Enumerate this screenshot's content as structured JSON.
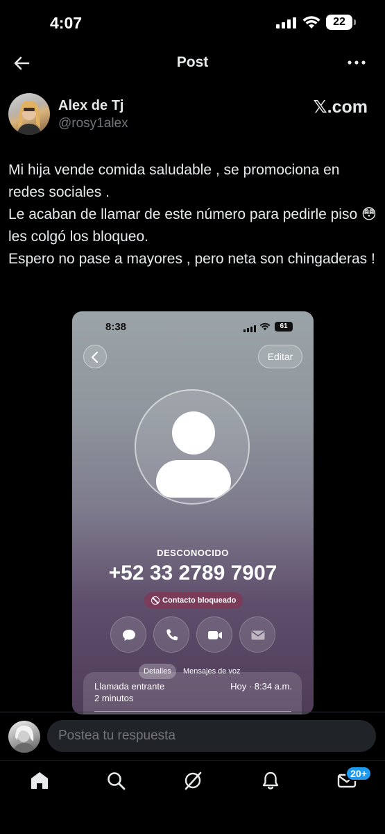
{
  "status_bar": {
    "time": "4:07",
    "battery": "22"
  },
  "header": {
    "title": "Post",
    "back_icon": "arrow-left-icon",
    "more_icon": "more-horizontal-icon"
  },
  "post": {
    "author_name": "Alex de Tj",
    "author_handle": "@rosy1alex",
    "source": "𝕏.com",
    "text_lines": [
      "Mi hija vende comida saludable , se promociona en redes sociales .",
      "Le acaban de llamar de este número para pedirle piso 😳 les colgó los bloqueo.",
      "Espero no pase a mayores , pero neta son chingaderas !"
    ]
  },
  "media": {
    "time": "8:38",
    "battery": "61",
    "edit_label": "Editar",
    "contact_label": "DESCONOCIDO",
    "phone_number": "+52 33 2789 7907",
    "blocked_label": "Contacto bloqueado",
    "tabs": [
      "Detalles",
      "Mensajes de voz"
    ],
    "call": {
      "type": "Llamada entrante",
      "time": "Hoy · 8:34 a.m.",
      "duration": "2 minutos"
    },
    "actions": [
      "message-icon",
      "phone-icon",
      "video-icon",
      "mail-icon"
    ]
  },
  "reply": {
    "placeholder": "Postea tu respuesta"
  },
  "nav": {
    "items": [
      "home-icon",
      "search-icon",
      "grok-icon",
      "notifications-icon",
      "messages-icon"
    ],
    "messages_badge": "20+"
  },
  "colors": {
    "background": "#000000",
    "accent": "#1d9bf0",
    "secondary_text": "#71767b",
    "blocked_pill": "#7b3c5a"
  }
}
